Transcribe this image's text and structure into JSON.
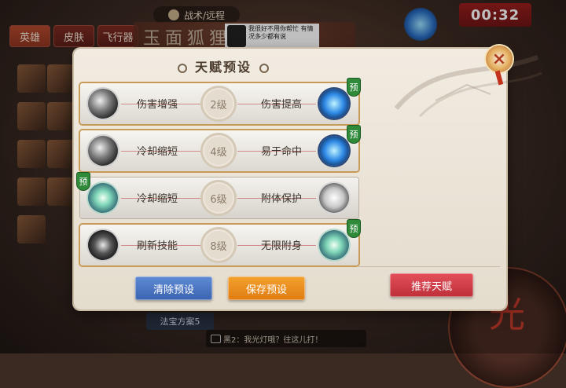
{
  "hud": {
    "tabs": [
      "英雄",
      "皮肤",
      "飞行器"
    ],
    "mode_label": "战术/远程",
    "title_banner": "玉面狐狸",
    "sign_text": "我很好不用你帮忙 有情况多少都有说",
    "timer": "00:32",
    "right_lines": [
      "",
      ""
    ],
    "bottom_label": "法宝方案5",
    "chat_text": "黑2：我光灯哦？往这儿打！",
    "big_glyph": "光"
  },
  "modal": {
    "title": "天赋预设",
    "close_label": "×",
    "rows": [
      {
        "left_name": "伤害增强",
        "level": "2级",
        "right_name": "伤害提高",
        "tag": "预",
        "tag_side": "right",
        "left_icon": "gray",
        "right_icon": "blue",
        "selected": true
      },
      {
        "left_name": "冷却缩短",
        "level": "4级",
        "right_name": "易于命中",
        "tag": "预",
        "tag_side": "right",
        "left_icon": "gray",
        "right_icon": "blue",
        "selected": true
      },
      {
        "left_name": "冷却缩短",
        "level": "6级",
        "right_name": "附体保护",
        "tag": "预",
        "tag_side": "left",
        "left_icon": "teal",
        "right_icon": "white",
        "selected": false
      },
      {
        "left_name": "刷新技能",
        "level": "8级",
        "right_name": "无限附身",
        "tag": "预",
        "tag_side": "right",
        "left_icon": "dark",
        "right_icon": "teal",
        "selected": true
      }
    ],
    "buttons": {
      "clear": "清除预设",
      "save": "保存预设",
      "recommend": "推荐天赋"
    }
  },
  "colors": {
    "clear_button": "#4a74c2",
    "save_button": "#ea8c1e",
    "recommend_button": "#d2404a",
    "tag_green": "#2f8a3a"
  }
}
